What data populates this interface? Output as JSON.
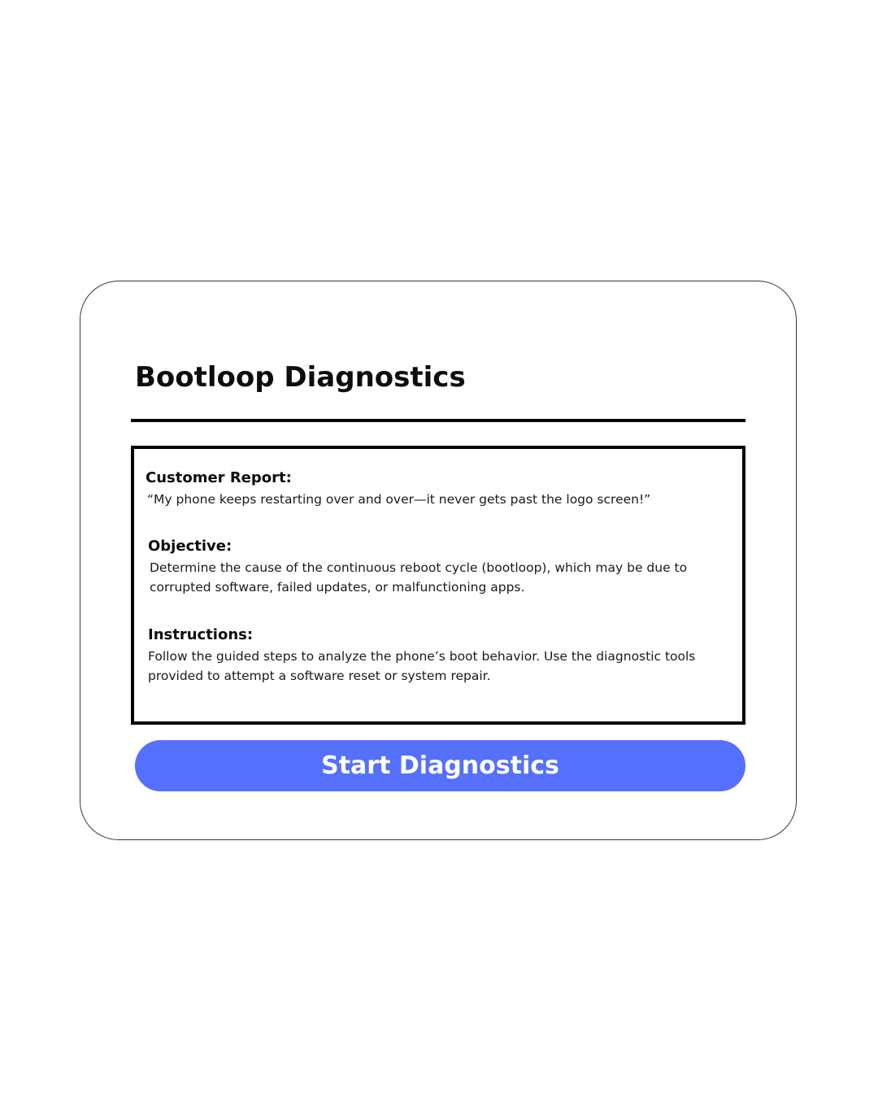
{
  "page": {
    "title": "Bootloop Diagnostics"
  },
  "sections": {
    "customer_report": {
      "heading": "Customer Report:",
      "text": "“My phone keeps restarting over and over—it never gets past the logo screen!”"
    },
    "objective": {
      "heading": "Objective:",
      "text": "Determine the cause of the continuous reboot cycle (bootloop), which may be due to corrupted software, failed updates, or malfunctioning apps."
    },
    "instructions": {
      "heading": "Instructions:",
      "text": "Follow the guided steps to analyze the phone’s boot behavior. Use the diagnostic tools provided to attempt a software reset or system repair."
    }
  },
  "actions": {
    "start_label": "Start Diagnostics"
  },
  "colors": {
    "accent": "#5470fd",
    "text": "#0d0d0d",
    "border": "#000000",
    "background": "#ffffff"
  }
}
